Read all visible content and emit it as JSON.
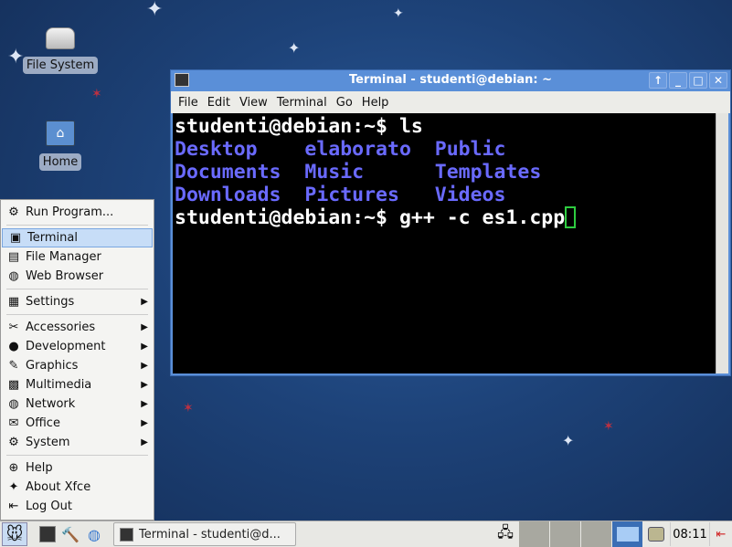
{
  "desktop": {
    "icons": [
      {
        "label": "File System",
        "icon": "drive-icon"
      },
      {
        "label": "Home",
        "icon": "home-folder-icon"
      }
    ]
  },
  "terminal": {
    "title": "Terminal - studenti@debian: ~",
    "menu": [
      "File",
      "Edit",
      "View",
      "Terminal",
      "Go",
      "Help"
    ],
    "lines": {
      "l1": "studenti@debian:~$ ls",
      "ls": [
        [
          "Desktop",
          "elaborato",
          "Public"
        ],
        [
          "Documents",
          "Music",
          "Templates"
        ],
        [
          "Downloads",
          "Pictures",
          "Videos"
        ]
      ],
      "l5": "studenti@debian:~$ g++ -c es1.cpp"
    },
    "ls_color": "#6a6aff",
    "cursor_color": "#2ecc40"
  },
  "menu": {
    "items": [
      {
        "label": "Run Program...",
        "icon": "run-icon"
      },
      {
        "label": "Terminal",
        "icon": "terminal-icon",
        "highlighted": true
      },
      {
        "label": "File Manager",
        "icon": "file-manager-icon"
      },
      {
        "label": "Web Browser",
        "icon": "globe-icon"
      },
      {
        "label": "Settings",
        "icon": "settings-icon",
        "submenu": true
      },
      {
        "label": "Accessories",
        "icon": "scissors-icon",
        "submenu": true
      },
      {
        "label": "Development",
        "icon": "hardhat-icon",
        "submenu": true
      },
      {
        "label": "Graphics",
        "icon": "brush-icon",
        "submenu": true
      },
      {
        "label": "Multimedia",
        "icon": "clapper-icon",
        "submenu": true
      },
      {
        "label": "Network",
        "icon": "globe-icon",
        "submenu": true
      },
      {
        "label": "Office",
        "icon": "office-icon",
        "submenu": true
      },
      {
        "label": "System",
        "icon": "gear-icon",
        "submenu": true
      },
      {
        "label": "Help",
        "icon": "help-icon"
      },
      {
        "label": "About Xfce",
        "icon": "star-icon"
      },
      {
        "label": "Log Out",
        "icon": "logout-icon"
      }
    ]
  },
  "panel": {
    "task": "Terminal - studenti@d...",
    "clock": "08:11",
    "active_workspace": 1,
    "workspaces": 4
  }
}
